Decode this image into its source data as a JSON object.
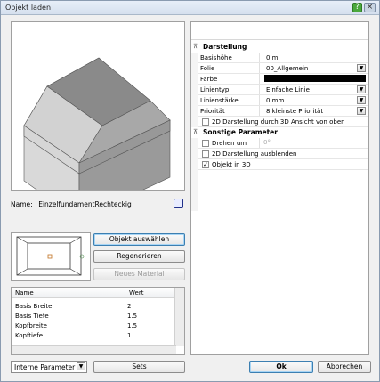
{
  "window": {
    "title": "Objekt laden"
  },
  "preview": {
    "name_label": "Name:",
    "name_value": "EinzelfundamentRechteckig"
  },
  "buttons": {
    "select_object": "Objekt auswählen",
    "regenerate": "Regenerieren",
    "new_material": "Neues Material",
    "sets": "Sets",
    "ok": "Ok",
    "cancel": "Abbrechen"
  },
  "params_table": {
    "headers": [
      "Name",
      "Wert"
    ],
    "rows": [
      {
        "name": "Basis Breite",
        "value": "2"
      },
      {
        "name": "Basis Tiefe",
        "value": "1.5"
      },
      {
        "name": "Kopfbreite",
        "value": "1.5"
      },
      {
        "name": "Kopftiefe",
        "value": "1"
      }
    ]
  },
  "param_mode": {
    "selected": "Interne Parameter"
  },
  "properties": {
    "section_display": "Darstellung",
    "rows": [
      {
        "label": "Basishöhe",
        "value": "0 m"
      },
      {
        "label": "Folie",
        "value": "00_Allgemein"
      },
      {
        "label": "Farbe",
        "value": ""
      },
      {
        "label": "Linientyp",
        "value": "Einfache Linie"
      },
      {
        "label": "Linienstärke",
        "value": "0 mm"
      },
      {
        "label": "Priorität",
        "value": "8 kleinste Priorität"
      }
    ],
    "check_2d_through_3d": "2D Darstellung durch 3D Ansicht von oben",
    "section_other": "Sonstige Parameter",
    "rotate_label": "Drehen um",
    "rotate_value": "0°",
    "hide_2d_label": "2D Darstellung ausblenden",
    "object_3d_label": "Objekt in 3D"
  },
  "colors": {
    "color_swatch": "#000000"
  }
}
